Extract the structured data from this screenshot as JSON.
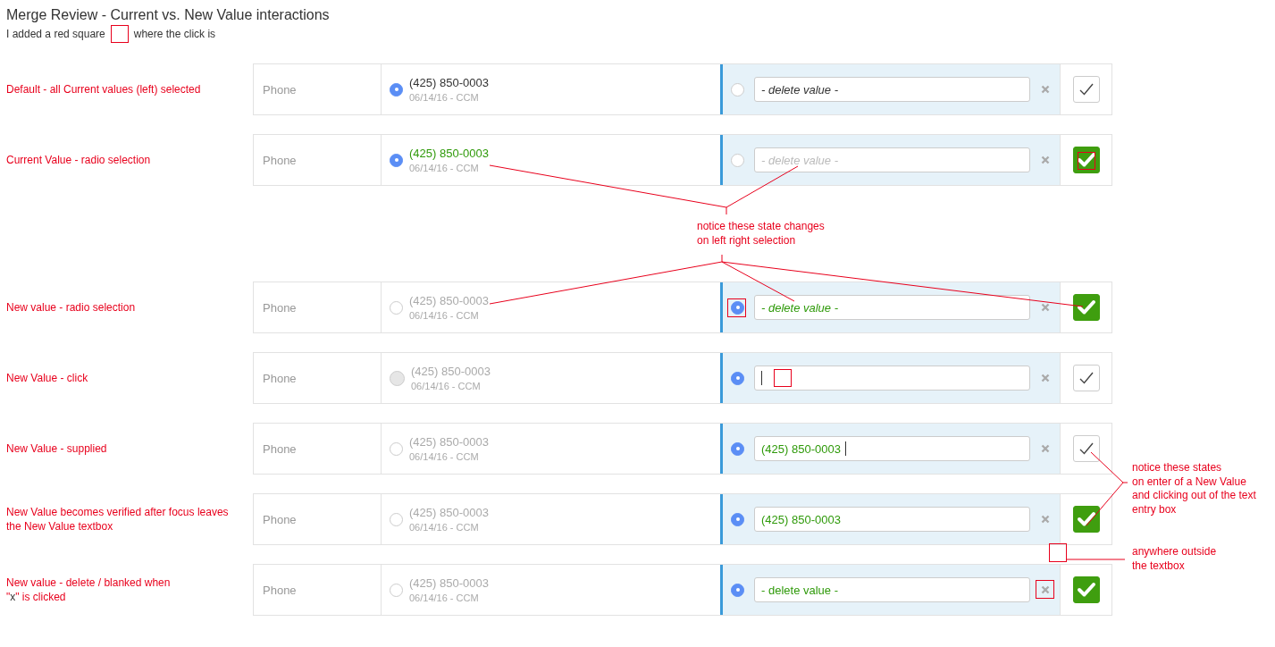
{
  "title": "Merge Review - Current vs. New Value interactions",
  "subtitle": {
    "before": "I added a red square",
    "after": "where the click is"
  },
  "rows_top": [
    {
      "label": [
        {
          "text": "Default - all Current values (left) selected",
          "dark": false
        }
      ],
      "field": "Phone",
      "current": {
        "selected": true,
        "value": "(425) 850-0003",
        "changed": false,
        "disabled": false,
        "meta": "06/14/16 - CCM"
      },
      "new": {
        "selected": false,
        "value": "- delete value -",
        "changed": false,
        "italic": true
      },
      "verified": false
    },
    {
      "label": [
        {
          "text": "Current Value - radio selection",
          "dark": false
        }
      ],
      "field": "Phone",
      "current": {
        "selected": true,
        "value": "(425) 850-0003",
        "changed": true,
        "meta": "06/14/16 - CCM"
      },
      "new": {
        "selected": false,
        "placeholder": "- delete value -"
      },
      "verified": true,
      "verify_clicked": true
    }
  ],
  "note": [
    "notice these state changes",
    "on left right selection"
  ],
  "rows_bottom": [
    {
      "label": [
        {
          "text": "New value - radio selection",
          "dark": false
        }
      ],
      "field": "Phone",
      "current": {
        "selected": false,
        "value": "(425) 850-0003",
        "changed": false,
        "disabled": true,
        "meta": "06/14/16 - CCM"
      },
      "new": {
        "selected": true,
        "radio_clicked": true,
        "value": "- delete value -",
        "changed": true,
        "italic": true
      },
      "verified": true
    },
    {
      "label": [
        {
          "text": "New Value - click",
          "dark": false
        }
      ],
      "field": "Phone",
      "current": {
        "selected": false,
        "hovered": true,
        "value": "(425) 850-0003",
        "changed": false,
        "disabled": true,
        "meta": "06/14/16 - CCM"
      },
      "new": {
        "selected": true,
        "changed": true,
        "italic": false,
        "caret": true,
        "input_clicked": true
      },
      "verified": false
    },
    {
      "label": [
        {
          "text": "New Value - supplied",
          "dark": false
        }
      ],
      "field": "Phone",
      "current": {
        "selected": false,
        "value": "(425) 850-0003",
        "changed": false,
        "disabled": true,
        "meta": "06/14/16 - CCM"
      },
      "new": {
        "selected": true,
        "value": "(425) 850-0003",
        "changed": true,
        "italic": false,
        "caret": true
      },
      "verified": false
    },
    {
      "label": [
        {
          "text": "New Value becomes verified after focus leaves the New Value textbox",
          "dark": false
        }
      ],
      "field": "Phone",
      "current": {
        "selected": false,
        "value": "(425) 850-0003",
        "changed": false,
        "disabled": true,
        "meta": "06/14/16 - CCM"
      },
      "new": {
        "selected": true,
        "value": "(425) 850-0003",
        "changed": true,
        "italic": false
      },
      "verified": true
    },
    {
      "label": [
        {
          "text": "New value - delete / blanked when\n\"",
          "dark": false
        },
        {
          "text": "x",
          "dark": true
        },
        {
          "text": "\" is clicked",
          "dark": false
        }
      ],
      "field": "Phone",
      "current": {
        "selected": false,
        "value": "(425) 850-0003",
        "changed": false,
        "disabled": true,
        "meta": "06/14/16 - CCM"
      },
      "new": {
        "selected": true,
        "value": "- delete value -",
        "changed": true,
        "italic": false,
        "clear_clicked": true
      },
      "verified": true
    }
  ],
  "side_notes": [
    {
      "lines": [
        "notice these states",
        "on enter of a New Value",
        "and clicking out of the text",
        "entry box"
      ]
    },
    {
      "lines": [
        "anywhere outside",
        "the textbox"
      ]
    }
  ]
}
